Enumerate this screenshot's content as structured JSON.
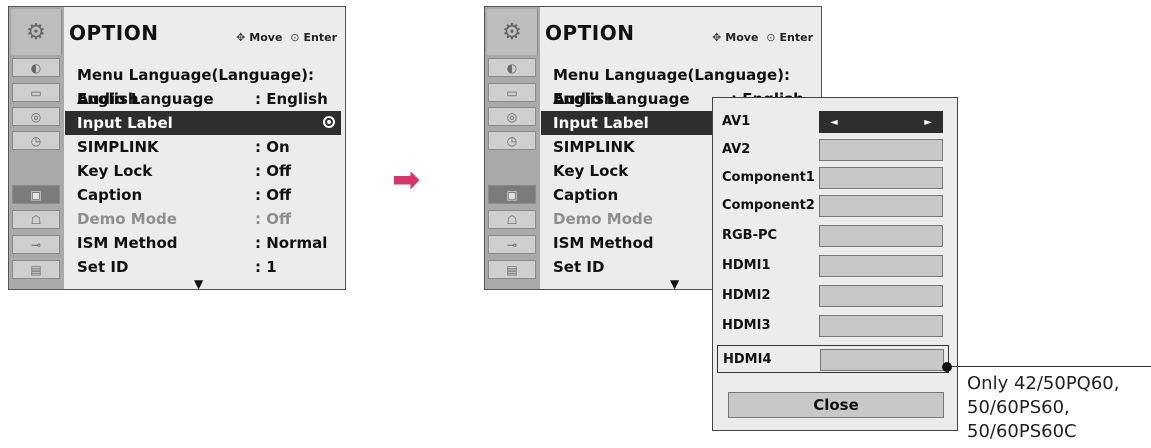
{
  "left_menu": {
    "title": "OPTION",
    "hint_move": "Move",
    "hint_enter": "Enter",
    "items": [
      {
        "label": "Menu Language(Language): English",
        "value": ""
      },
      {
        "label": "Audio Language",
        "value": ": English"
      },
      {
        "label": "Input Label",
        "value": ""
      },
      {
        "label": "SIMPLINK",
        "value": ": On"
      },
      {
        "label": "Key Lock",
        "value": ": Off"
      },
      {
        "label": "Caption",
        "value": ": Off"
      },
      {
        "label": "Demo Mode",
        "value": ": Off"
      },
      {
        "label": "ISM Method",
        "value": ": Normal"
      },
      {
        "label": "Set ID",
        "value": ": 1"
      }
    ]
  },
  "right_menu": {
    "title": "OPTION",
    "hint_move": "Move",
    "hint_enter": "Enter",
    "items": [
      {
        "label": "Menu Language(Language): English"
      },
      {
        "label": "Audio Language",
        "value": ": English"
      },
      {
        "label": "Input Label"
      },
      {
        "label": "SIMPLINK"
      },
      {
        "label": "Key Lock"
      },
      {
        "label": "Caption"
      },
      {
        "label": "Demo Mode"
      },
      {
        "label": "ISM Method"
      },
      {
        "label": "Set ID"
      }
    ]
  },
  "popup": {
    "inputs": [
      "AV1",
      "AV2",
      "Component1",
      "Component2",
      "RGB-PC",
      "HDMI1",
      "HDMI2",
      "HDMI3",
      "HDMI4"
    ],
    "close_label": "Close"
  },
  "note": {
    "line1": "Only 42/50PQ60,",
    "line2": "50/60PS60,",
    "line3": "50/60PS60C"
  },
  "colors": {
    "accent_arrow": "#d8366a",
    "selected_row": "#2e2e2e"
  }
}
